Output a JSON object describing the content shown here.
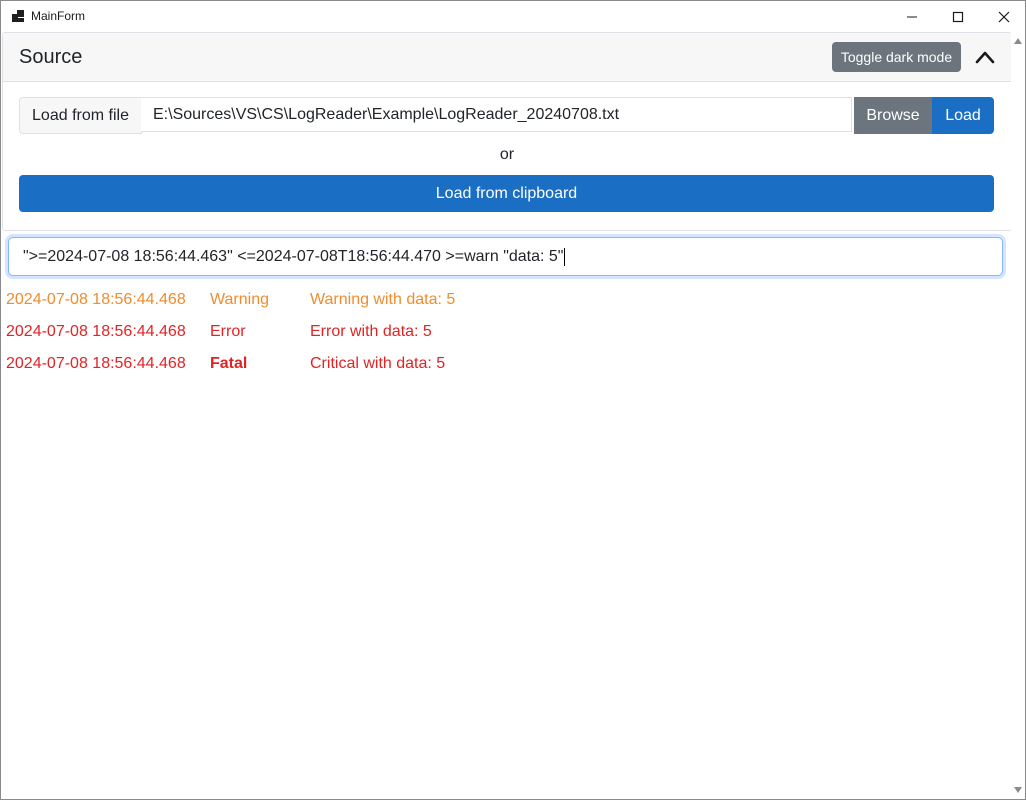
{
  "window": {
    "title": "MainForm"
  },
  "source": {
    "title": "Source",
    "toggle_label": "Toggle dark mode",
    "file_label": "Load from file",
    "file_path": "E:\\Sources\\VS\\CS\\LogReader\\Example\\LogReader_20240708.txt",
    "browse_label": "Browse",
    "load_label": "Load",
    "or_text": "or",
    "clipboard_label": "Load from clipboard"
  },
  "filter": {
    "value": "\">=2024-07-08 18:56:44.463\" <=2024-07-08T18:56:44.470 >=warn \"data: 5\""
  },
  "log": [
    {
      "time": "2024-07-08 18:56:44.468",
      "level": "Warning",
      "message": "Warning with data: 5"
    },
    {
      "time": "2024-07-08 18:56:44.468",
      "level": "Error",
      "message": "Error with data: 5"
    },
    {
      "time": "2024-07-08 18:56:44.468",
      "level": "Fatal",
      "message": "Critical with data: 5"
    }
  ],
  "colors": {
    "accent": "#1a6fc4",
    "secondary": "#6c757d",
    "warning": "#f08c2e",
    "error": "#e02424"
  },
  "icons": [
    "app-icon",
    "minimize-icon",
    "maximize-icon",
    "close-icon",
    "chevron-up-icon",
    "scroll-up-icon",
    "scroll-down-icon"
  ]
}
